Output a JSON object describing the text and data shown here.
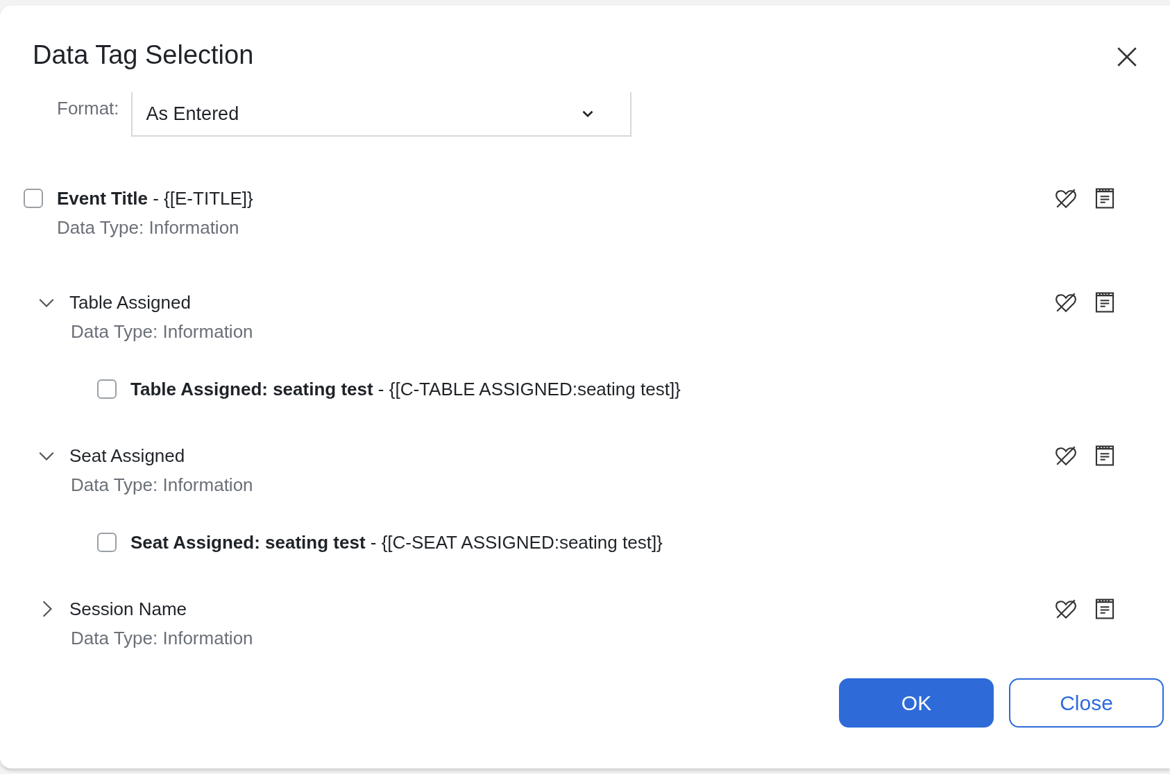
{
  "dialog": {
    "title": "Data Tag Selection"
  },
  "format": {
    "label": "Format:",
    "value": "As Entered"
  },
  "items": [
    {
      "kind": "tag",
      "text": "**Event Title** - {[E-TITLE]}",
      "subtitle": "Data Type: Information",
      "checked": false
    },
    {
      "kind": "group",
      "text": "Table Assigned",
      "subtitle": "Data Type: Information",
      "expanded": true,
      "children": [
        {
          "kind": "tag",
          "text": "**Table Assigned: seating test** - {[C-TABLE ASSIGNED:seating test]}",
          "checked": false
        }
      ]
    },
    {
      "kind": "group",
      "text": "Seat Assigned",
      "subtitle": "Data Type: Information",
      "expanded": true,
      "children": [
        {
          "kind": "tag",
          "text": "**Seat Assigned: seating test** - {[C-SEAT ASSIGNED:seating test]}",
          "checked": false
        }
      ]
    },
    {
      "kind": "group",
      "text": "Session Name",
      "subtitle": "Data Type: Information",
      "expanded": false
    }
  ],
  "buttons": [
    {
      "label": "OK",
      "kind": "primary"
    },
    {
      "label": "Close",
      "kind": "secondary"
    }
  ]
}
